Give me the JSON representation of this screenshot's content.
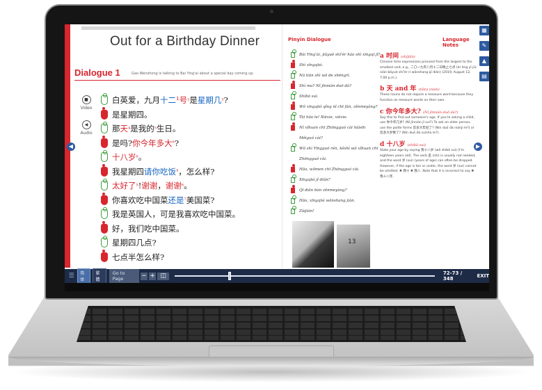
{
  "book": {
    "title": "Out for a Birthday Dinner",
    "dialogue_heading": "Dialogue 1",
    "dialogue_subtitle": "Gao Wenzhong is talking to Bai Ying'ai about a special day coming up."
  },
  "media": {
    "video_label": "Video",
    "audio_label": "Audio"
  },
  "dialogue_lines": [
    {
      "speaker": "female",
      "parts": [
        {
          "t": "白英爱，九月"
        },
        {
          "t": "十二",
          "c": "blue"
        },
        {
          "t": "¹号",
          "c": "red"
        },
        {
          "t": "²",
          "c": "red"
        },
        {
          "t": "是"
        },
        {
          "t": "星期几",
          "c": "blue"
        },
        {
          "t": "³",
          "c": "red"
        },
        {
          "t": "?"
        }
      ]
    },
    {
      "speaker": "male",
      "parts": [
        {
          "t": "是星期四。"
        }
      ]
    },
    {
      "speaker": "female",
      "parts": [
        {
          "t": "那"
        },
        {
          "t": "天",
          "c": "red"
        },
        {
          "t": "⁴",
          "c": "red"
        },
        {
          "t": "是我的"
        },
        {
          "t": "⁵",
          "c": "red"
        },
        {
          "t": "生日。"
        }
      ]
    },
    {
      "speaker": "male",
      "parts": [
        {
          "t": "是吗? "
        },
        {
          "t": "你今年多大",
          "c": "red"
        },
        {
          "t": "⁶",
          "c": "red"
        },
        {
          "t": "?"
        }
      ]
    },
    {
      "speaker": "female",
      "parts": [
        {
          "t": "十八岁",
          "c": "red"
        },
        {
          "t": "⁶",
          "c": "red"
        },
        {
          "t": "。"
        }
      ]
    },
    {
      "speaker": "male",
      "parts": [
        {
          "t": "我星期四"
        },
        {
          "t": "请你吃饭",
          "c": "blue"
        },
        {
          "t": "⁴",
          "c": "red"
        },
        {
          "t": "，怎么样?"
        }
      ]
    },
    {
      "speaker": "female",
      "parts": [
        {
          "t": "太好了",
          "c": "red"
        },
        {
          "t": "⁵",
          "c": "red"
        },
        {
          "t": "! "
        },
        {
          "t": "谢谢",
          "c": "red"
        },
        {
          "t": "，"
        },
        {
          "t": "谢谢",
          "c": "red"
        },
        {
          "t": "⁶",
          "c": "red"
        },
        {
          "t": "。"
        }
      ]
    },
    {
      "speaker": "male",
      "parts": [
        {
          "t": "你喜欢吃中国菜"
        },
        {
          "t": "还是",
          "c": "blue"
        },
        {
          "t": "⁷",
          "c": "red"
        },
        {
          "t": "美国菜?"
        }
      ]
    },
    {
      "speaker": "female",
      "parts": [
        {
          "t": "我是英国人，可是我喜欢吃中国菜。"
        }
      ]
    },
    {
      "speaker": "male",
      "parts": [
        {
          "t": "好，我们吃中国菜。"
        }
      ]
    },
    {
      "speaker": "female",
      "parts": [
        {
          "t": "星期四几点?"
        }
      ]
    },
    {
      "speaker": "male",
      "parts": [
        {
          "t": "七点半怎么样?"
        }
      ]
    }
  ],
  "pinyin_section": {
    "heading": "Pinyin Dialogue",
    "lines": [
      "Bái Yīng'ài, jiǔyuè shí'èr hào shì xīngqī jǐ?",
      "Shì xīngqīsì.",
      "Nà tiān shì wǒ de shēngrì.",
      "Shì ma? Nǐ jīnnián duō dà?",
      "Shíbā suì.",
      "Wǒ xīngqīsì qǐng nǐ chī fàn, zěnmeyàng?",
      "Tài hǎo le! Xièxie, xièxie.",
      "Nǐ xǐhuan chī Zhōngguó cài háishi",
      "Měiguó cài?",
      "Wǒ shì Yīngguó rén, kěshì wǒ xǐhuan chī",
      "Zhōngguó cài.",
      "Hǎo, wǒmen chī Zhōngguó cài.",
      "Xīngqīsì jǐ diǎn?",
      "Qī diǎn bàn zěnmeyàng?",
      "Hǎo, xīngqīsì wǎnshang jiàn.",
      "Zàijiàn!"
    ],
    "photo_label": "13"
  },
  "language_notes": {
    "heading": "Language Notes",
    "items": [
      {
        "letter": "a",
        "head": "时间",
        "head_py": "(shíjiān)",
        "text": "Chinese time expressions proceed from the largest to the smallest unit, e.g., 二〇一九年八月十二日晚上七点 (èr líng yī jiǔ nián bāyuè shí'èr rì wǎnshang qī diǎn) (2019, August 12, 7:00 p.m.)."
      },
      {
        "letter": "b",
        "head": "天 and 年",
        "head_py": "(tiān) (nián)",
        "text": "These nouns do not require a measure word because they function as measure words on their own."
      },
      {
        "letter": "c",
        "head": "你今年多大?",
        "head_py": "(Nǐ jīnnián duō dà?)",
        "text": "Say this to find out someone's age. If you're asking a child, use 你今年几岁? (Nǐ jīnnián jǐ suì?) To ask an older person, use the polite forms 您多大年纪了? (Nín duō dà niánjì le?) or 您多大岁数了? (Nín duō dà suìshù le?)."
      },
      {
        "letter": "d",
        "head": "十八岁",
        "head_py": "(shíbā suì)",
        "text": "State your age by saying 我十八岁 (wǒ shíbā suì) (I'm eighteen years old). The verb 是 (shì) is usually not needed, and the word 岁 (suì) (years of age) can often be dropped. However, if the age is ten or under, the word 岁 (suì) cannot be omitted. ✖ 我十 ✖ 我八. Note that it is incorrect to say ✖ 我十八年."
      }
    ]
  },
  "toolbar": {
    "simplified_label": "简体",
    "traditional_label": "繁體",
    "go_to_page_label": "Go to Page",
    "zoom_out_label": "−",
    "zoom_in_label": "+",
    "page_indicator": "72-73 / 348",
    "exit_label": "EXIT",
    "progress": 0.21
  },
  "colors": {
    "accent_red": "#d7262e",
    "accent_blue": "#1565c0",
    "toolbar_bg": "#1d2b46",
    "tool_blue": "#2e5ba0"
  }
}
